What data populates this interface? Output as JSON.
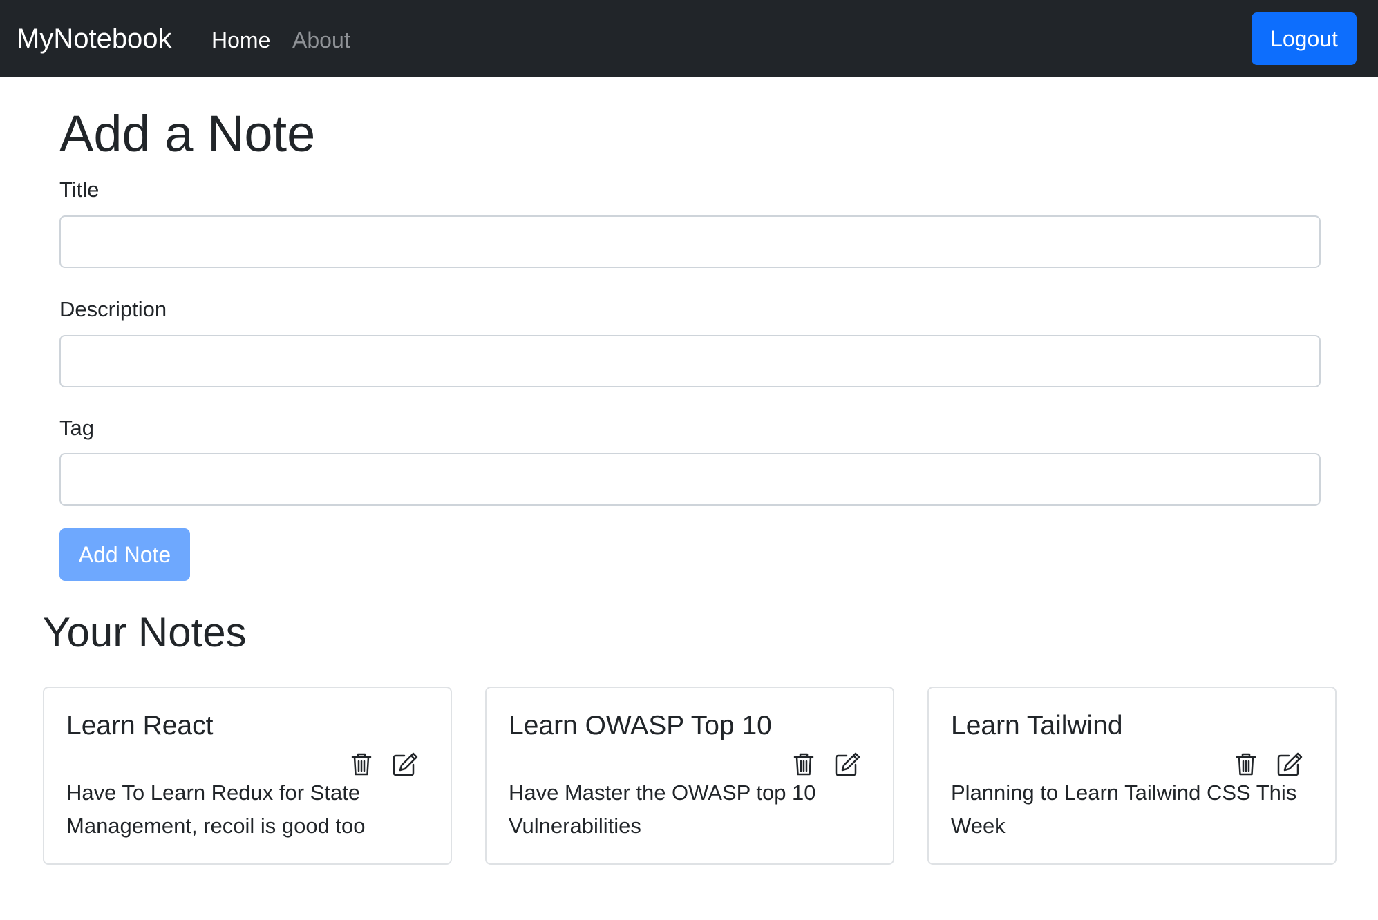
{
  "navbar": {
    "brand": "MyNotebook",
    "links": [
      {
        "label": "Home",
        "active": true
      },
      {
        "label": "About",
        "active": false
      }
    ],
    "logout_label": "Logout",
    "accent_color": "#0d6efd"
  },
  "add_note": {
    "heading": "Add a Note",
    "fields": [
      {
        "label": "Title",
        "value": "",
        "placeholder": ""
      },
      {
        "label": "Description",
        "value": "",
        "placeholder": ""
      },
      {
        "label": "Tag",
        "value": "",
        "placeholder": ""
      }
    ],
    "button_label": "Add Note",
    "button_disabled": true
  },
  "notes": {
    "heading": "Your Notes",
    "items": [
      {
        "title": "Learn React",
        "description": "Have To Learn Redux for State Management, recoil is good too",
        "actions": [
          "trash-icon",
          "edit-icon"
        ]
      },
      {
        "title": "Learn OWASP Top 10",
        "description": "Have Master the OWASP top 10 Vulnerabilities",
        "actions": [
          "trash-icon",
          "edit-icon"
        ]
      },
      {
        "title": "Learn Tailwind",
        "description": "Planning to Learn Tailwind CSS This Week",
        "actions": [
          "trash-icon",
          "edit-icon"
        ]
      }
    ]
  }
}
